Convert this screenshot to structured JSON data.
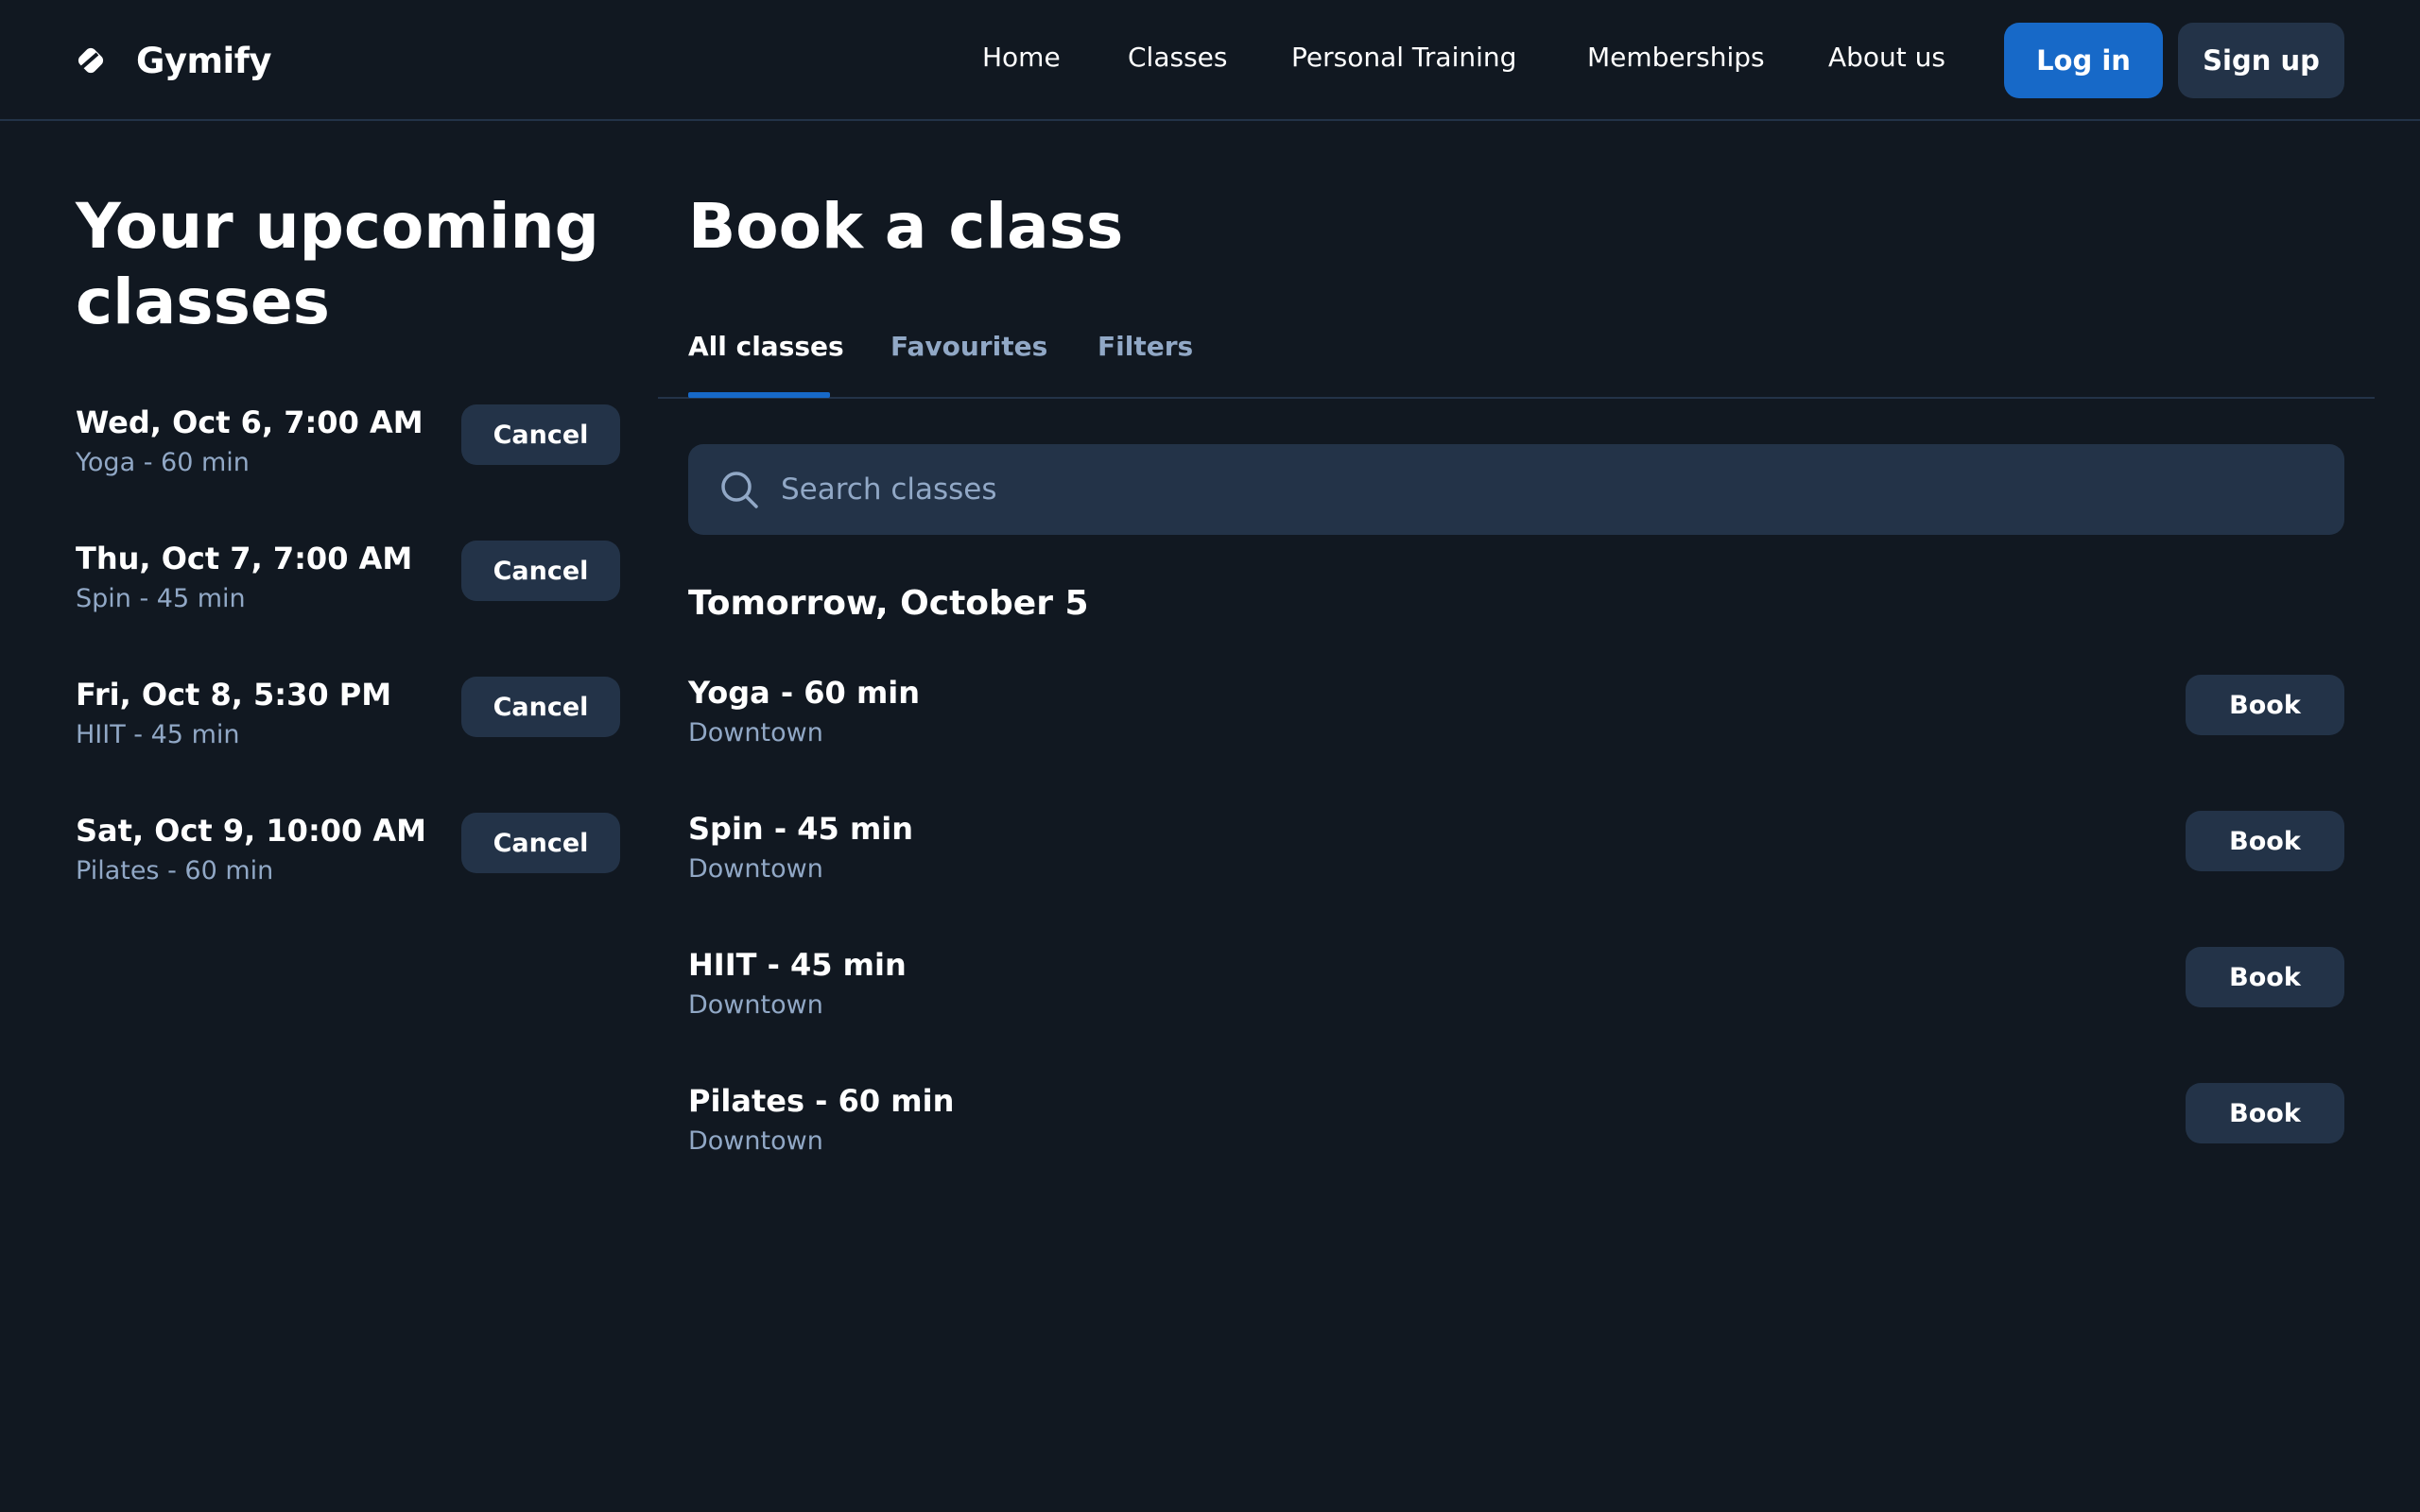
{
  "brand": {
    "name": "Gymify",
    "icon": "brand-logo-icon"
  },
  "nav": {
    "items": [
      "Home",
      "Classes",
      "Personal Training",
      "Memberships",
      "About us"
    ],
    "login_label": "Log in",
    "signup_label": "Sign up"
  },
  "upcoming": {
    "title": "Your upcoming classes",
    "cancel_label": "Cancel",
    "items": [
      {
        "date": "Wed, Oct 6, 7:00 AM",
        "meta": "Yoga - 60 min"
      },
      {
        "date": "Thu, Oct 7, 7:00 AM",
        "meta": "Spin - 45 min"
      },
      {
        "date": "Fri, Oct 8, 5:30 PM",
        "meta": "HIIT - 45 min"
      },
      {
        "date": "Sat, Oct 9, 10:00 AM",
        "meta": "Pilates - 60 min"
      }
    ]
  },
  "booking": {
    "title": "Book a class",
    "tabs": [
      {
        "label": "All classes",
        "active": true
      },
      {
        "label": "Favourites",
        "active": false
      },
      {
        "label": "Filters",
        "active": false
      }
    ],
    "search": {
      "placeholder": "Search classes",
      "value": "",
      "icon": "search-icon"
    },
    "day_heading": "Tomorrow, October 5",
    "book_label": "Book",
    "classes": [
      {
        "name": "Yoga - 60 min",
        "location": "Downtown"
      },
      {
        "name": "Spin - 45 min",
        "location": "Downtown"
      },
      {
        "name": "HIIT - 45 min",
        "location": "Downtown"
      },
      {
        "name": "Pilates - 60 min",
        "location": "Downtown"
      }
    ]
  },
  "colors": {
    "background": "#111821",
    "surface": "#233348",
    "accent": "#1769c8",
    "muted_text": "#91a8c6"
  }
}
